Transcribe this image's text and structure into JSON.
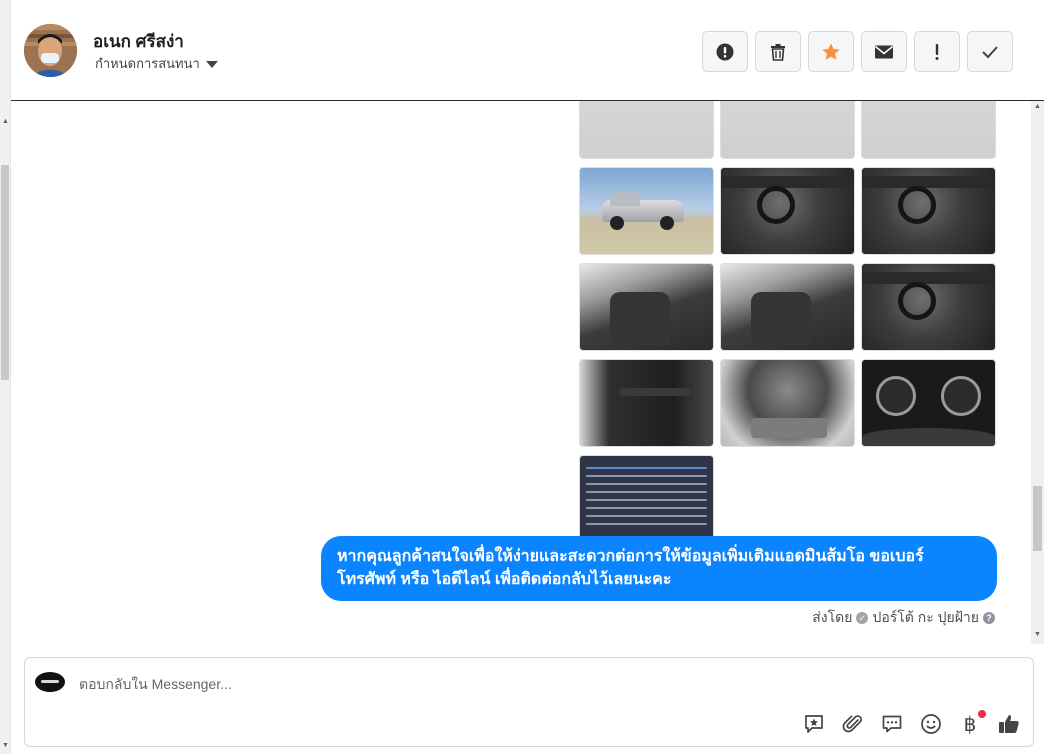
{
  "contact": {
    "name": "อเนก ศรีสง่า",
    "label_prompt": "กำหนดการสนทนา"
  },
  "header_actions": [
    {
      "name": "report-button",
      "icon": "exclamation-circle-icon"
    },
    {
      "name": "delete-button",
      "icon": "trash-icon"
    },
    {
      "name": "star-button",
      "icon": "star-icon",
      "color": "#f7923b"
    },
    {
      "name": "mark-unread-button",
      "icon": "envelope-icon"
    },
    {
      "name": "important-button",
      "icon": "exclamation-icon"
    },
    {
      "name": "mark-done-button",
      "icon": "checkmark-icon"
    }
  ],
  "photos": [
    {
      "name": "photo-rear-1",
      "kind": "road"
    },
    {
      "name": "photo-rear-2",
      "kind": "road"
    },
    {
      "name": "photo-rear-3",
      "kind": "road"
    },
    {
      "name": "photo-side",
      "kind": "sky"
    },
    {
      "name": "photo-dashboard",
      "kind": "interior"
    },
    {
      "name": "photo-gearshift",
      "kind": "interior"
    },
    {
      "name": "photo-front-seat-1",
      "kind": "seat"
    },
    {
      "name": "photo-front-seat-2",
      "kind": "seat"
    },
    {
      "name": "photo-cabin",
      "kind": "interior"
    },
    {
      "name": "photo-door-panel",
      "kind": "door"
    },
    {
      "name": "photo-engine",
      "kind": "engine"
    },
    {
      "name": "photo-gauges",
      "kind": "gauge"
    },
    {
      "name": "photo-spec-sheet",
      "kind": "spec"
    }
  ],
  "message": {
    "text": "หากคุณลูกค้าสนใจเพื่อให้ง่ายและสะดวกต่อการให้ข้อมูลเพิ่มเติมแอดมินส้มโอ ขอเบอร์โทรศัพท์ หรือ ไอดีไลน์ เพื่อติดต่อกลับไว้เลยนะคะ",
    "sent_by_prefix": "ส่งโดย",
    "sent_by_name": "ปอร์โต้ กะ ปุยฝ้าย",
    "color": "#0a84ff"
  },
  "composer": {
    "placeholder": "ตอบกลับใน Messenger...",
    "tools": [
      "saved-reply-icon",
      "attachment-icon",
      "chat-icon",
      "emoji-icon",
      "baht-payment-icon",
      "thumbs-up-icon"
    ],
    "baht_symbol": "฿"
  }
}
